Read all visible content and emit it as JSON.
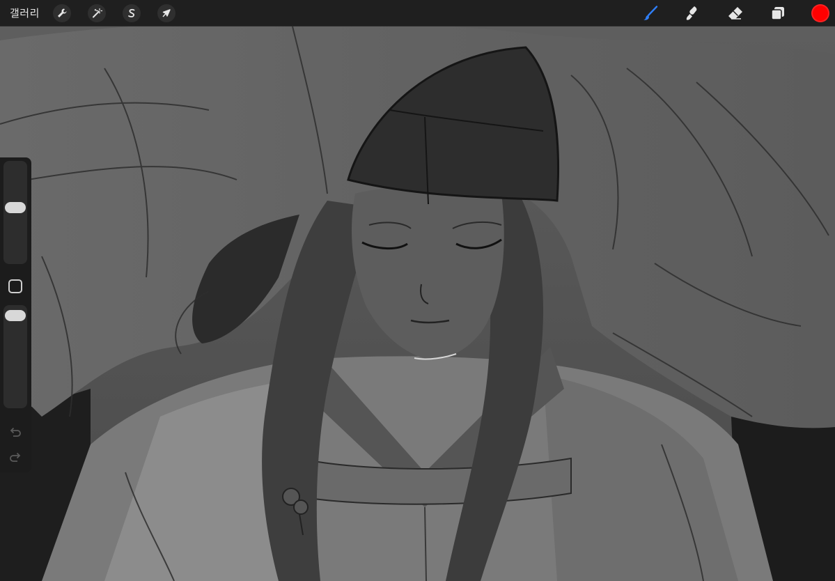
{
  "topbar": {
    "gallery_label": "갤러리",
    "left_tools": [
      {
        "name": "actions",
        "icon": "wrench-icon"
      },
      {
        "name": "adjustments",
        "icon": "magic-wand-icon"
      },
      {
        "name": "selection",
        "icon": "selection-s-icon"
      },
      {
        "name": "transform",
        "icon": "arrow-cursor-icon"
      }
    ],
    "right_tools": [
      {
        "name": "brush",
        "icon": "brush-icon",
        "active": true
      },
      {
        "name": "smudge",
        "icon": "smudge-icon",
        "active": false
      },
      {
        "name": "eraser",
        "icon": "eraser-icon",
        "active": false
      },
      {
        "name": "layers",
        "icon": "layers-icon",
        "active": false
      }
    ],
    "current_color": "#ff0000",
    "active_tool_color": "#2f7ef6"
  },
  "sidebar": {
    "brush_size_level": 0.55,
    "opacity_level": 0.95,
    "icons": [
      "square-modify-icon",
      "undo-icon",
      "redo-icon"
    ]
  },
  "canvas": {
    "description_icon": "sketch-artwork",
    "background_color": "#595959"
  }
}
